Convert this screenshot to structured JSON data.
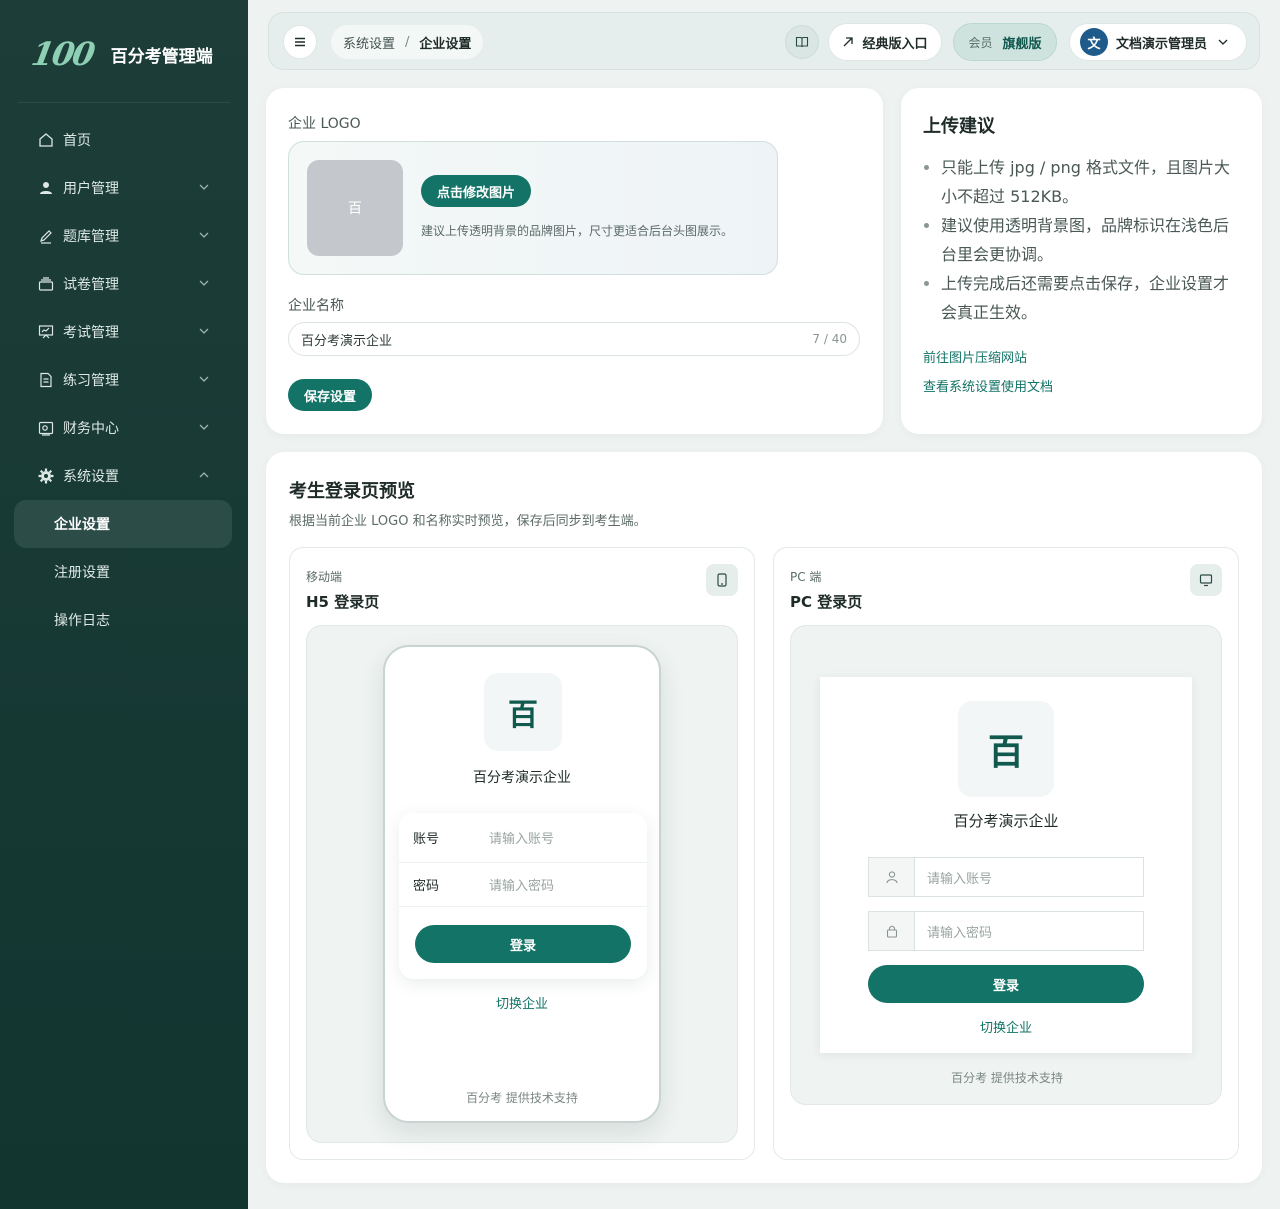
{
  "brand": {
    "logo": "100",
    "name": "百分考管理端"
  },
  "menu": [
    {
      "label": "首页",
      "icon": "home-icon",
      "expandable": false
    },
    {
      "label": "用户管理",
      "icon": "user-icon",
      "expandable": true
    },
    {
      "label": "题库管理",
      "icon": "pen-icon",
      "expandable": true
    },
    {
      "label": "试卷管理",
      "icon": "paper-stack-icon",
      "expandable": true
    },
    {
      "label": "考试管理",
      "icon": "presentation-icon",
      "expandable": true
    },
    {
      "label": "练习管理",
      "icon": "document-icon",
      "expandable": true
    },
    {
      "label": "财务中心",
      "icon": "wallet-icon",
      "expandable": true
    },
    {
      "label": "系统设置",
      "icon": "gear-icon",
      "expandable": true,
      "expanded": true
    }
  ],
  "submenu": [
    {
      "label": "企业设置",
      "active": true
    },
    {
      "label": "注册设置",
      "active": false
    },
    {
      "label": "操作日志",
      "active": false
    }
  ],
  "topbar": {
    "breadcrumb_parent": "系统设置",
    "breadcrumb_sep": "/",
    "breadcrumb_current": "企业设置",
    "classic_entry": "经典版入口",
    "member_label": "会员",
    "member_level": "旗舰版",
    "user_avatar": "文",
    "user_name": "文档演示管理员"
  },
  "settings": {
    "logo_label": "企业 LOGO",
    "logo_placeholder": "百",
    "change_image_button": "点击修改图片",
    "logo_hint": "建议上传透明背景的品牌图片，尺寸更适合后台头图展示。",
    "name_label": "企业名称",
    "name_value": "百分考演示企业",
    "name_counter": "7 / 40",
    "save_button": "保存设置"
  },
  "tips": {
    "title": "上传建议",
    "items": [
      "只能上传 jpg / png 格式文件，且图片大小不超过 512KB。",
      "建议使用透明背景图，品牌标识在浅色后台里会更协调。",
      "上传完成后还需要点击保存，企业设置才会真正生效。"
    ],
    "link_compress": "前往图片压缩网站",
    "link_docs": "查看系统设置使用文档"
  },
  "preview": {
    "title": "考生登录页预览",
    "subtitle": "根据当前企业 LOGO 和名称实时预览，保存后同步到考生端。",
    "mobile": {
      "platform": "移动端",
      "title": "H5 登录页",
      "logo_char": "百",
      "company": "百分考演示企业",
      "account_label": "账号",
      "account_placeholder": "请输入账号",
      "password_label": "密码",
      "password_placeholder": "请输入密码",
      "login_button": "登录",
      "switch_link": "切换企业",
      "footer": "百分考 提供技术支持"
    },
    "pc": {
      "platform": "PC 端",
      "title": "PC 登录页",
      "logo_char": "百",
      "company": "百分考演示企业",
      "account_placeholder": "请输入账号",
      "password_placeholder": "请输入密码",
      "login_button": "登录",
      "switch_link": "切换企业",
      "footer": "百分考 提供技术支持"
    }
  },
  "colors": {
    "sidebar": "#17392f",
    "accent": "#137366",
    "page_bg": "#eef2f1"
  }
}
